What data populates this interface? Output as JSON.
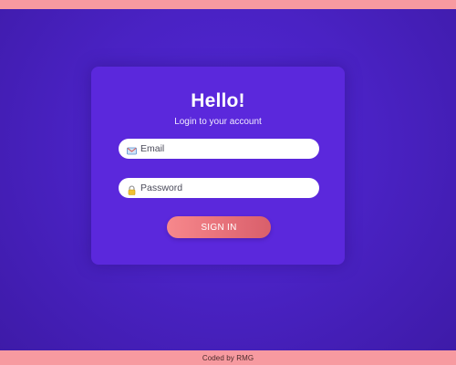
{
  "login": {
    "title": "Hello!",
    "subtitle": "Login to your account",
    "email": {
      "placeholder": "Email",
      "value": "",
      "icon": "envelope-icon"
    },
    "password": {
      "placeholder": "Password",
      "value": "",
      "icon": "lock-icon"
    },
    "submit_label": "SIGN IN"
  },
  "footer": {
    "credit": "Coded by RMG"
  },
  "colors": {
    "background": "#4a22c4",
    "card": "#5b28dc",
    "accent_bar": "#f79aa0",
    "button_start": "#f7888c",
    "button_end": "#d95f6b"
  }
}
